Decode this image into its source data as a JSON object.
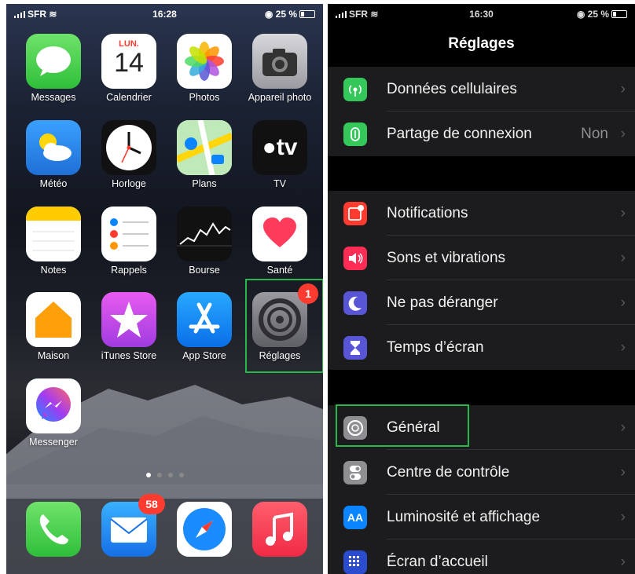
{
  "home": {
    "status": {
      "carrier": "SFR",
      "time": "16:28",
      "battery": "25 %"
    },
    "calendar_day": "LUN.",
    "calendar_date": "14",
    "tv_text": "tv",
    "apps": [
      {
        "label": "Messages"
      },
      {
        "label": "Calendrier"
      },
      {
        "label": "Photos"
      },
      {
        "label": "Appareil photo"
      },
      {
        "label": "Météo"
      },
      {
        "label": "Horloge"
      },
      {
        "label": "Plans"
      },
      {
        "label": "TV"
      },
      {
        "label": "Notes"
      },
      {
        "label": "Rappels"
      },
      {
        "label": "Bourse"
      },
      {
        "label": "Santé"
      },
      {
        "label": "Maison"
      },
      {
        "label": "iTunes Store"
      },
      {
        "label": "App Store"
      },
      {
        "label": "Réglages",
        "badge": "1"
      },
      {
        "label": "Messenger"
      }
    ],
    "dock": [
      {
        "icon": "phone-icon"
      },
      {
        "icon": "mail-icon",
        "badge": "58"
      },
      {
        "icon": "safari-icon"
      },
      {
        "icon": "music-icon"
      }
    ],
    "page_dots": 4,
    "highlight_color": "#28b84a"
  },
  "settings": {
    "status": {
      "carrier": "SFR",
      "time": "16:30",
      "battery": "25 %"
    },
    "title": "Réglages",
    "groups": [
      [
        {
          "label": "Données cellulaires",
          "icon": "cellular-icon",
          "color": "#34c759"
        },
        {
          "label": "Partage de connexion",
          "value": "Non",
          "icon": "hotspot-icon",
          "color": "#34c759"
        }
      ],
      [
        {
          "label": "Notifications",
          "icon": "notifications-icon",
          "color": "#ff3b30"
        },
        {
          "label": "Sons et vibrations",
          "icon": "sound-icon",
          "color": "#ff2d55"
        },
        {
          "label": "Ne pas déranger",
          "icon": "moon-icon",
          "color": "#5856d6"
        },
        {
          "label": "Temps d’écran",
          "icon": "hourglass-icon",
          "color": "#5856d6"
        }
      ],
      [
        {
          "label": "Général",
          "icon": "gear-icon",
          "color": "#8e8e93"
        },
        {
          "label": "Centre de contrôle",
          "icon": "toggles-icon",
          "color": "#8e8e93"
        },
        {
          "label": "Luminosité et affichage",
          "icon": "brightness-icon",
          "color": "#0a84ff",
          "icon_text": "AA"
        },
        {
          "label": "Écran d’accueil",
          "icon": "home-screen-icon",
          "color": "#2c4ccf"
        }
      ]
    ],
    "chevron": "›"
  }
}
